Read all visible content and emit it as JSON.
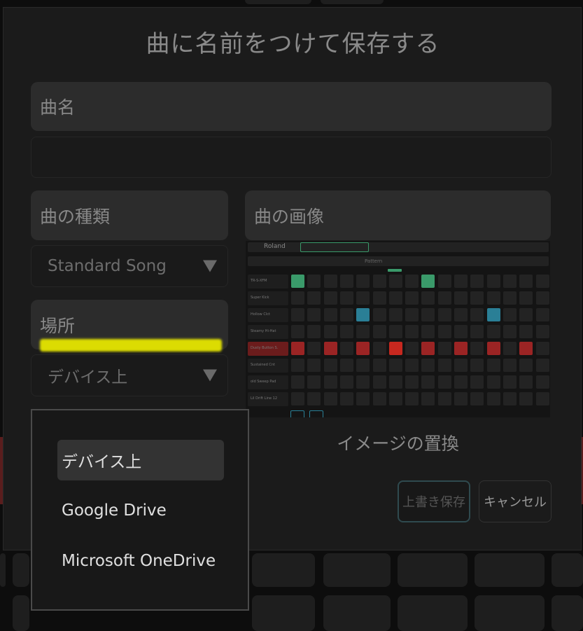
{
  "dialog": {
    "title": "曲に名前をつけて保存する",
    "song_name_label": "曲名",
    "song_name_value": "",
    "song_type_label": "曲の種類",
    "song_type_value": "Standard Song",
    "location_label": "場所",
    "location_value": "デバイス上",
    "song_image_label": "曲の画像",
    "replace_image_label": "イメージの置換",
    "save_button": "上書き保存",
    "cancel_button": "キャンセル"
  },
  "location_menu": {
    "items": [
      "デバイス上",
      "Google Drive",
      "Microsoft OneDrive"
    ],
    "selected_index": 0
  },
  "thumbnail": {
    "brand": "Roland",
    "tracks": [
      "TR-S-XFM",
      "Super Kick",
      "Hollow Clct",
      "Steamy Hi-Hat",
      "Dusty Button S.",
      "Sustained Cnt",
      "old Sweep Pad",
      "Lil Drift Line 12"
    ],
    "pattern_label": "Pattern",
    "accent_colors": {
      "green": "#3a9a6a",
      "teal": "#2a7f96",
      "red": "#9b2424",
      "bright_red": "#c7281f"
    }
  }
}
